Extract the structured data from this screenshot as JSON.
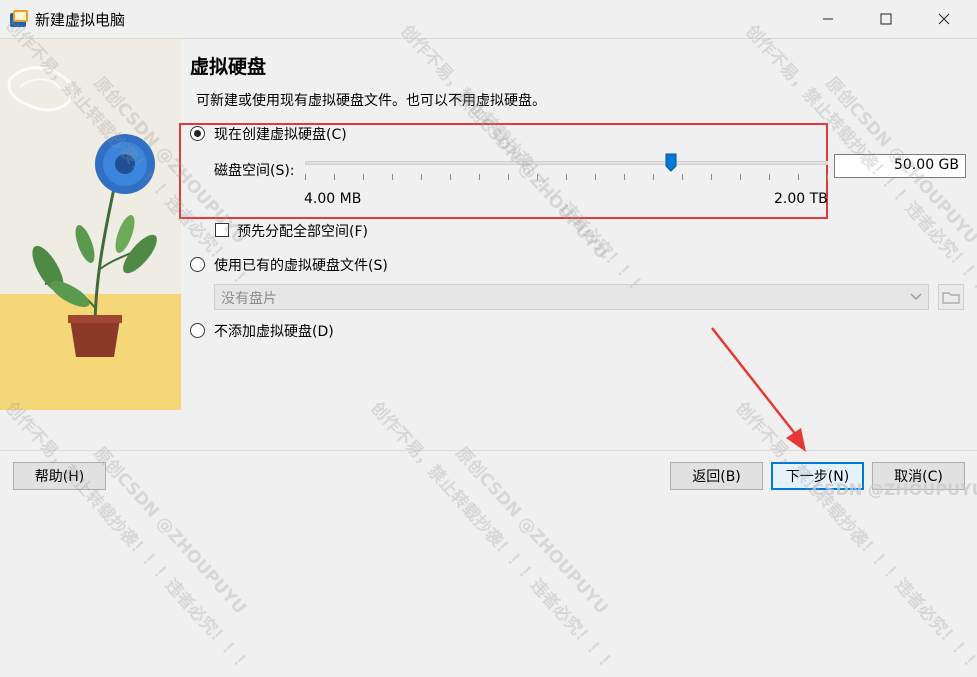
{
  "window": {
    "title": "新建虚拟电脑"
  },
  "page": {
    "heading": "虚拟硬盘",
    "subtitle": "可新建或使用现有虚拟硬盘文件。也可以不用虚拟硬盘。"
  },
  "options": {
    "create_new_label": "现在创建虚拟硬盘(C)",
    "use_existing_label": "使用已有的虚拟硬盘文件(S)",
    "no_disk_label": "不添加虚拟硬盘(D)",
    "selected": "create_new"
  },
  "disk": {
    "label": "磁盘空间(S):",
    "value": "50.00 GB",
    "min_label": "4.00 MB",
    "max_label": "2.00 TB",
    "slider_fraction": 0.7
  },
  "preallocate": {
    "label": "预先分配全部空间(F)",
    "checked": false
  },
  "existing": {
    "selected_value": "没有盘片"
  },
  "footer": {
    "help_label": "帮助(H)",
    "back_label": "返回(B)",
    "next_label": "下一步(N)",
    "cancel_label": "取消(C)"
  },
  "watermarks": [
    "创作不易，禁止转载抄袭！！！违者必究！！！",
    "原创CSDN @ZHOUPUYU",
    "CSDN @ZHOUPUYU"
  ],
  "colors": {
    "highlight": "#e03a3a",
    "accent": "#0078d7",
    "arrow": "#e53935"
  }
}
